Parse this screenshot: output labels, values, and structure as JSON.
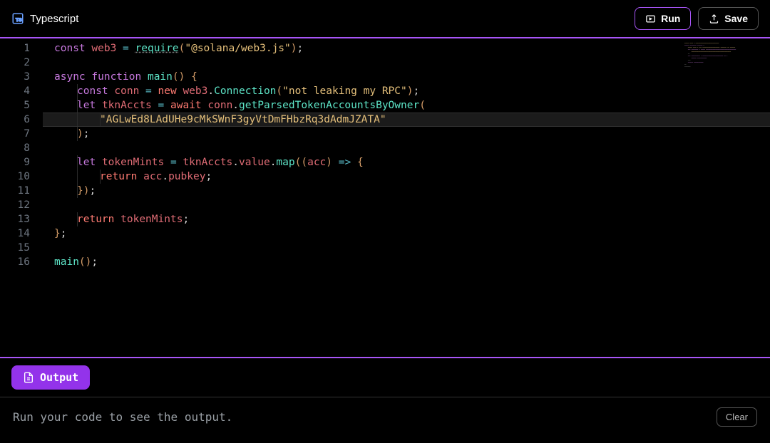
{
  "header": {
    "language": "Typescript",
    "run_label": "Run",
    "save_label": "Save"
  },
  "editor": {
    "highlighted_line": 6,
    "line_count": 16,
    "lines": [
      {
        "n": 1,
        "indent": 0,
        "tokens": [
          [
            "kw",
            "const"
          ],
          [
            "pun",
            " "
          ],
          [
            "id",
            "web3"
          ],
          [
            "pun",
            " "
          ],
          [
            "op",
            "="
          ],
          [
            "pun",
            " "
          ],
          [
            "fn ud",
            "require"
          ],
          [
            "paren",
            "("
          ],
          [
            "str",
            "\"@solana/web3.js\""
          ],
          [
            "paren",
            ")"
          ],
          [
            "pun",
            ";"
          ]
        ]
      },
      {
        "n": 2,
        "indent": 0,
        "tokens": []
      },
      {
        "n": 3,
        "indent": 0,
        "tokens": [
          [
            "kw",
            "async"
          ],
          [
            "pun",
            " "
          ],
          [
            "kw",
            "function"
          ],
          [
            "pun",
            " "
          ],
          [
            "fn",
            "main"
          ],
          [
            "paren",
            "()"
          ],
          [
            "pun",
            " "
          ],
          [
            "paren",
            "{"
          ]
        ]
      },
      {
        "n": 4,
        "indent": 1,
        "tokens": [
          [
            "kw",
            "const"
          ],
          [
            "pun",
            " "
          ],
          [
            "id",
            "conn"
          ],
          [
            "pun",
            " "
          ],
          [
            "op",
            "="
          ],
          [
            "pun",
            " "
          ],
          [
            "kw2",
            "new"
          ],
          [
            "pun",
            " "
          ],
          [
            "id",
            "web3"
          ],
          [
            "pun",
            "."
          ],
          [
            "fn",
            "Connection"
          ],
          [
            "paren",
            "("
          ],
          [
            "str",
            "\"not leaking my RPC\""
          ],
          [
            "paren",
            ")"
          ],
          [
            "pun",
            ";"
          ]
        ]
      },
      {
        "n": 5,
        "indent": 1,
        "tokens": [
          [
            "kw",
            "let"
          ],
          [
            "pun",
            " "
          ],
          [
            "id",
            "tknAccts"
          ],
          [
            "pun",
            " "
          ],
          [
            "op",
            "="
          ],
          [
            "pun",
            " "
          ],
          [
            "kw2",
            "await"
          ],
          [
            "pun",
            " "
          ],
          [
            "id",
            "conn"
          ],
          [
            "pun",
            "."
          ],
          [
            "fn",
            "getParsedTokenAccountsByOwner"
          ],
          [
            "paren",
            "("
          ]
        ]
      },
      {
        "n": 6,
        "indent": 2,
        "tokens": [
          [
            "str",
            "\"AGLwEd8LAdUHe9cMkSWnF3gyVtDmFHbzRq3dAdmJZATA\""
          ]
        ]
      },
      {
        "n": 7,
        "indent": 1,
        "tokens": [
          [
            "paren",
            ")"
          ],
          [
            "pun",
            ";"
          ]
        ]
      },
      {
        "n": 8,
        "indent": 0,
        "tokens": []
      },
      {
        "n": 9,
        "indent": 1,
        "tokens": [
          [
            "kw",
            "let"
          ],
          [
            "pun",
            " "
          ],
          [
            "id",
            "tokenMints"
          ],
          [
            "pun",
            " "
          ],
          [
            "op",
            "="
          ],
          [
            "pun",
            " "
          ],
          [
            "id",
            "tknAccts"
          ],
          [
            "pun",
            "."
          ],
          [
            "prop",
            "value"
          ],
          [
            "pun",
            "."
          ],
          [
            "fn",
            "map"
          ],
          [
            "paren",
            "(("
          ],
          [
            "id",
            "acc"
          ],
          [
            "paren",
            ")"
          ],
          [
            "pun",
            " "
          ],
          [
            "op",
            "=>"
          ],
          [
            "pun",
            " "
          ],
          [
            "paren",
            "{"
          ]
        ]
      },
      {
        "n": 10,
        "indent": 2,
        "tokens": [
          [
            "kw2",
            "return"
          ],
          [
            "pun",
            " "
          ],
          [
            "id",
            "acc"
          ],
          [
            "pun",
            "."
          ],
          [
            "prop",
            "pubkey"
          ],
          [
            "pun",
            ";"
          ]
        ]
      },
      {
        "n": 11,
        "indent": 1,
        "tokens": [
          [
            "paren",
            "}"
          ],
          [
            "paren",
            ")"
          ],
          [
            "pun",
            ";"
          ]
        ]
      },
      {
        "n": 12,
        "indent": 0,
        "tokens": []
      },
      {
        "n": 13,
        "indent": 1,
        "tokens": [
          [
            "kw2",
            "return"
          ],
          [
            "pun",
            " "
          ],
          [
            "id",
            "tokenMints"
          ],
          [
            "pun",
            ";"
          ]
        ]
      },
      {
        "n": 14,
        "indent": 0,
        "tokens": [
          [
            "paren",
            "}"
          ],
          [
            "pun",
            ";"
          ]
        ]
      },
      {
        "n": 15,
        "indent": 0,
        "tokens": []
      },
      {
        "n": 16,
        "indent": 0,
        "tokens": [
          [
            "fn",
            "main"
          ],
          [
            "paren",
            "()"
          ],
          [
            "pun",
            ";"
          ]
        ]
      }
    ]
  },
  "output": {
    "tab_label": "Output",
    "placeholder": "Run your code to see the output.",
    "clear_label": "Clear"
  }
}
